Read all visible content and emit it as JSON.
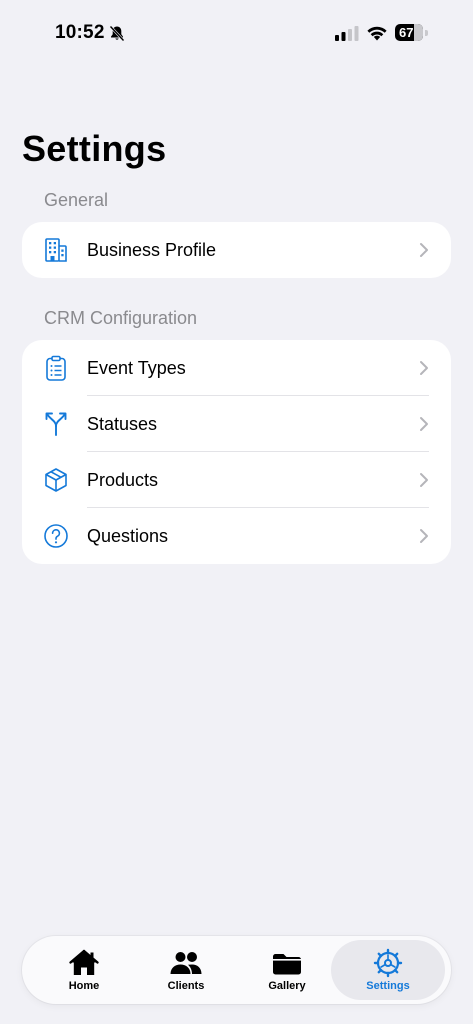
{
  "status_bar": {
    "time": "10:52",
    "battery_percent": 67,
    "battery_label": "67"
  },
  "page": {
    "title": "Settings"
  },
  "sections": [
    {
      "header": "General",
      "items": [
        {
          "label": "Business Profile",
          "icon": "building-icon"
        }
      ]
    },
    {
      "header": "CRM Configuration",
      "items": [
        {
          "label": "Event Types",
          "icon": "clipboard-list-icon"
        },
        {
          "label": "Statuses",
          "icon": "branch-arrows-icon"
        },
        {
          "label": "Products",
          "icon": "box-icon"
        },
        {
          "label": "Questions",
          "icon": "question-circle-icon"
        }
      ]
    }
  ],
  "tab_bar": {
    "tabs": [
      {
        "label": "Home",
        "icon": "house-icon"
      },
      {
        "label": "Clients",
        "icon": "people-icon"
      },
      {
        "label": "Gallery",
        "icon": "folder-icon"
      },
      {
        "label": "Settings",
        "icon": "gear-icon",
        "active": true
      }
    ]
  },
  "colors": {
    "accent": "#1479d9",
    "background": "#f1f1f6",
    "secondary_text": "#8a8a8e"
  }
}
